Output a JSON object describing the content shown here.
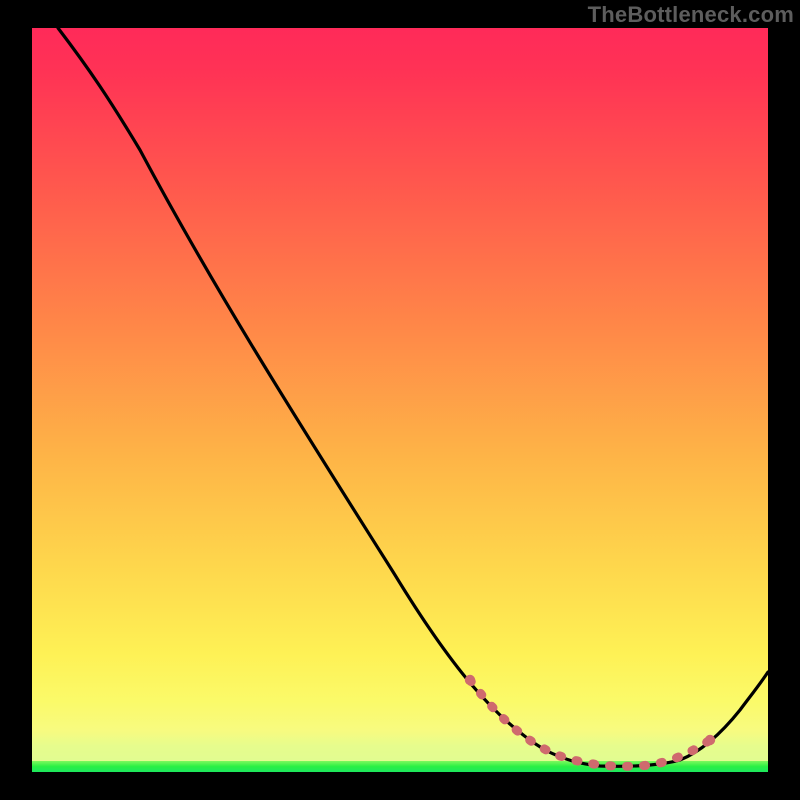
{
  "watermark": "TheBottleneck.com",
  "colors": {
    "black": "#000000",
    "curve": "#000000",
    "dots": "#cf6a6e",
    "green": "#29f044",
    "greenFade": "#6df85e",
    "yellowPale": "#f9fa6e",
    "yellow": "#fee551",
    "orange": "#fea048",
    "coral": "#ff6d4c",
    "red": "#ff3653",
    "redTop": "#ff2a59"
  },
  "chart_data": {
    "type": "line",
    "title": "",
    "xlabel": "",
    "ylabel": "",
    "xlim": [
      0,
      100
    ],
    "ylim": [
      0,
      100
    ],
    "grid": false,
    "series": [
      {
        "name": "curve",
        "x": [
          0,
          6,
          12,
          30,
          48,
          62,
          72,
          78,
          82,
          86,
          90,
          100
        ],
        "y": [
          100,
          96,
          90,
          66,
          42,
          24,
          10,
          3,
          1,
          1,
          3,
          17
        ]
      }
    ],
    "dot_markers": {
      "x": [
        62,
        67,
        70,
        73,
        76,
        80,
        83,
        86,
        88,
        90
      ],
      "y": [
        6,
        4,
        3,
        2,
        1.5,
        1,
        1,
        1.5,
        3,
        4.5
      ]
    },
    "annotations": []
  }
}
